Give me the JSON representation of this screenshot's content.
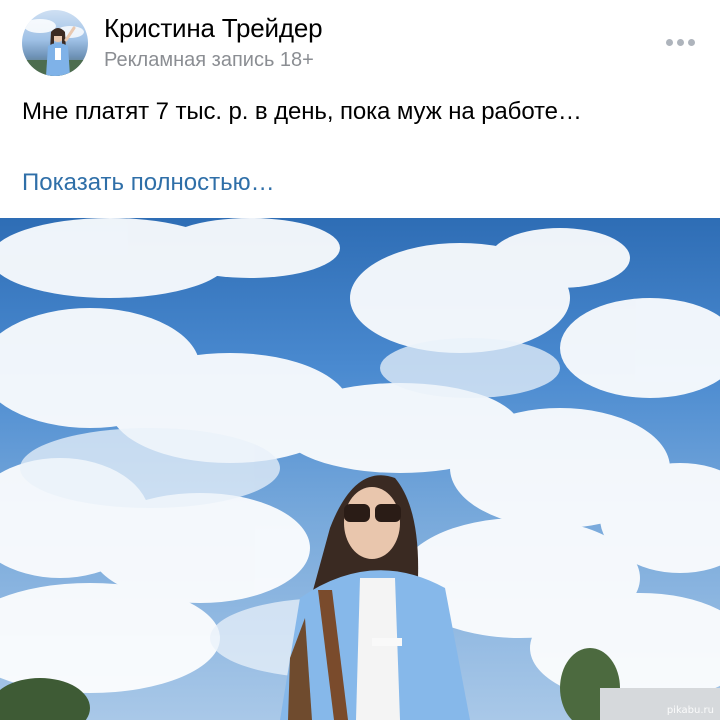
{
  "post": {
    "author": {
      "name": "Кристина Трейдер",
      "subtitle": "Рекламная запись 18+"
    },
    "more_icon": "more-dots-icon",
    "text": "Мне платят 7 тыс. р. в день, пока муж на работе…",
    "show_more_label": "Показать полностью…",
    "photo": {
      "watermark": "pikabu.ru"
    }
  },
  "colors": {
    "link": "#2f6fa8",
    "secondary_text": "#8b8e93",
    "sky": "#4a8ad0"
  }
}
